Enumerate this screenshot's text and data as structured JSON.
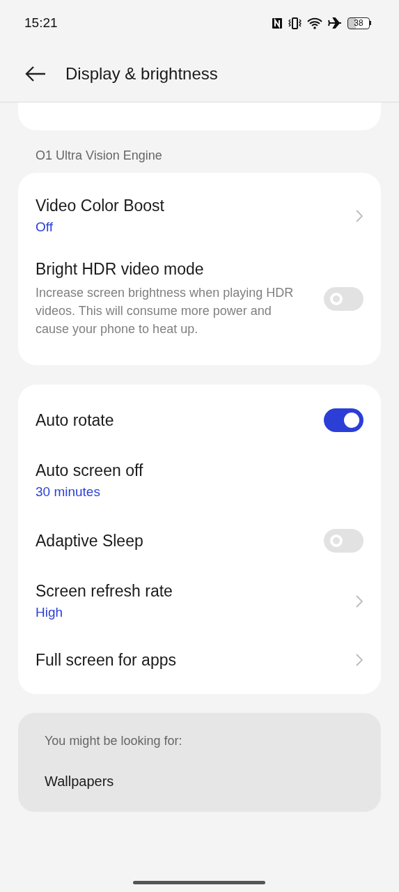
{
  "status_bar": {
    "time": "15:21",
    "battery": "38"
  },
  "header": {
    "title": "Display & brightness"
  },
  "sections": [
    {
      "partial": true
    },
    {
      "header": "O1 Ultra Vision Engine",
      "items": [
        {
          "kind": "link",
          "title": "Video Color Boost",
          "value": "Off"
        },
        {
          "kind": "switch",
          "title": "Bright HDR video mode",
          "description": "Increase screen brightness when playing HDR videos. This will consume more power and cause your phone to heat up.",
          "on": false
        }
      ]
    },
    {
      "items": [
        {
          "kind": "switch",
          "title": "Auto rotate",
          "on": true
        },
        {
          "kind": "text",
          "title": "Auto screen off",
          "value": "30 minutes"
        },
        {
          "kind": "switch",
          "title": "Adaptive Sleep",
          "on": false
        },
        {
          "kind": "link",
          "title": "Screen refresh rate",
          "value": "High"
        },
        {
          "kind": "link",
          "title": "Full screen for apps"
        }
      ]
    }
  ],
  "suggestions": {
    "label": "You might be looking for:",
    "items": [
      "Wallpapers"
    ]
  }
}
